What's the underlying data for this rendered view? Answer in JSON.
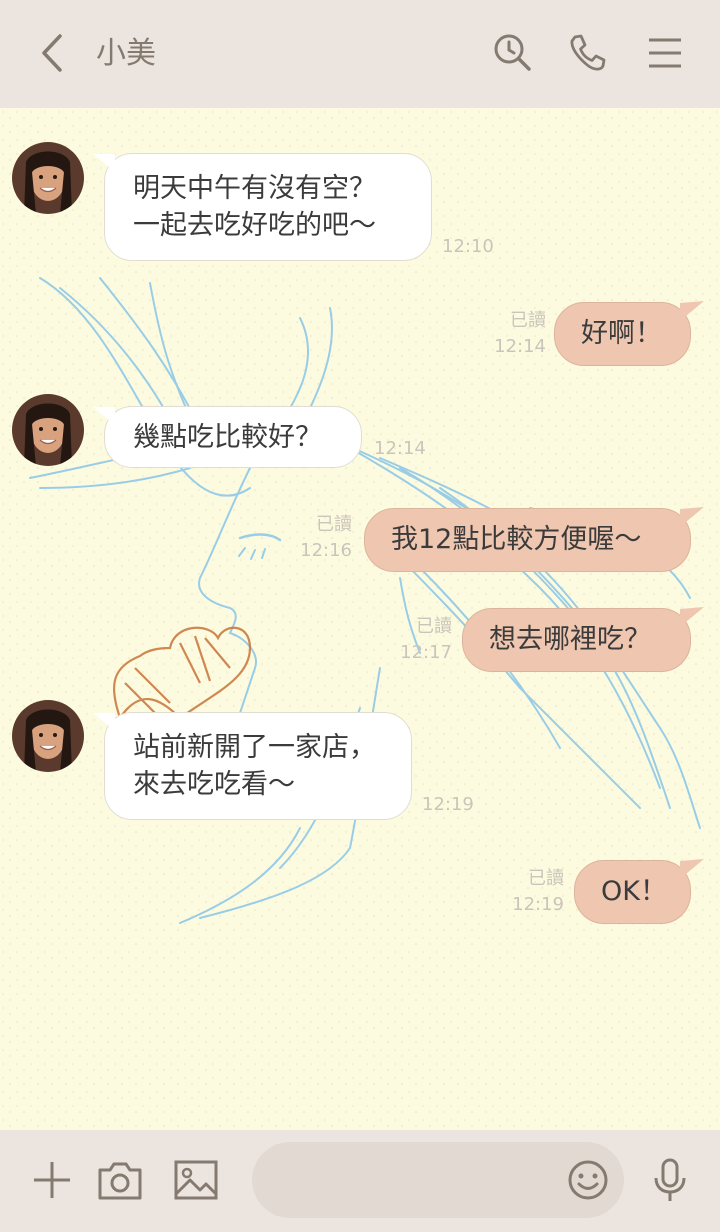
{
  "header": {
    "title": "小美",
    "icons": [
      "back-arrow-icon",
      "search-clock-icon",
      "phone-icon",
      "menu-icon"
    ]
  },
  "messages": [
    {
      "side": "in",
      "lines": [
        "明天中午有沒有空？",
        "一起去吃好吃的吧～"
      ],
      "time": "12:10"
    },
    {
      "side": "out",
      "text": "好啊！",
      "read": "已讀",
      "time": "12:14"
    },
    {
      "side": "in",
      "lines": [
        "幾點吃比較好？"
      ],
      "time": "12:14"
    },
    {
      "side": "out",
      "text": "我12點比較方便喔～",
      "read": "已讀",
      "time": "12:16"
    },
    {
      "side": "out",
      "text": "想去哪裡吃？",
      "read": "已讀",
      "time": "12:17"
    },
    {
      "side": "in",
      "lines": [
        "站前新開了一家店，",
        "來去吃吃看～"
      ],
      "time": "12:19"
    },
    {
      "side": "out",
      "text": "OK！",
      "read": "已讀",
      "time": "12:19"
    }
  ],
  "input": {
    "placeholder": "",
    "icons": [
      "plus-icon",
      "camera-icon",
      "image-icon",
      "emoji-icon",
      "microphone-icon"
    ]
  },
  "colors": {
    "header_bg": "#ece5df",
    "chat_bg": "#fdfbdf",
    "outgoing_bubble": "#efc7b0",
    "incoming_bubble": "#ffffff",
    "icon_color": "#857a70",
    "sketch_blue": "#8fc9e8",
    "sketch_orange": "#c8743a"
  }
}
